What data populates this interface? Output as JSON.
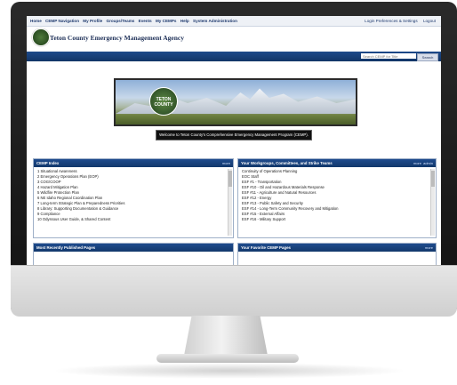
{
  "topnav": {
    "left_items": [
      "Home",
      "CEMP Navigation",
      "My Profile",
      "Groups/Teams",
      "Events",
      "My CEMPs",
      "Help",
      "System Administration"
    ],
    "right_items": [
      "Login Preferences & Settings",
      "Logout"
    ]
  },
  "brand": {
    "title": "Teton County Emergency Management Agency"
  },
  "search": {
    "placeholder": "Search CEMP for Title",
    "button": "Search"
  },
  "banner": {
    "seal_text": "TETON COUNTY"
  },
  "welcome_text": "Welcome to Teton County's Comprehensive Emergency Management Program (CEMP).",
  "cemp_index": {
    "title": "CEMP Index",
    "action": "more",
    "items": [
      "1 Situational Awareness",
      "2 Emergency Operations Plan (EOP)",
      "3 COG/COOP",
      "4 Hazard Mitigation Plan",
      "5 Wildfire Protection Plan",
      "6 NE Idaho Regional Coordination Plan",
      "7 Long-term Strategic Plan & Preparedness Priorities",
      "8 Library: Supporting Documentation & Guidance",
      "9 Compliance",
      "10 Odyssous User Guide, & Shared Content"
    ]
  },
  "workgroups": {
    "title": "Your Workgroups, Committees, and Strike Teams",
    "actions": [
      "more",
      "admin"
    ],
    "items": [
      "Continuity of Operations Planning",
      "EOC Staff",
      "ESF #1 - Transportation",
      "ESF #10 - Oil and Hazardous Materials Response",
      "ESF #11 - Agriculture and Natural Resources",
      "ESF #12 - Energy",
      "ESF #13 - Public Safety and Security",
      "ESF #14 - Long-Term Community Recovery and Mitigation",
      "ESF #15 - External Affairs",
      "ESF #16 - Military Support"
    ]
  },
  "recent_pages": {
    "title": "Most Recently Published Pages"
  },
  "favorite_pages": {
    "title": "Your Favorite CEMP Pages",
    "action": "more"
  }
}
